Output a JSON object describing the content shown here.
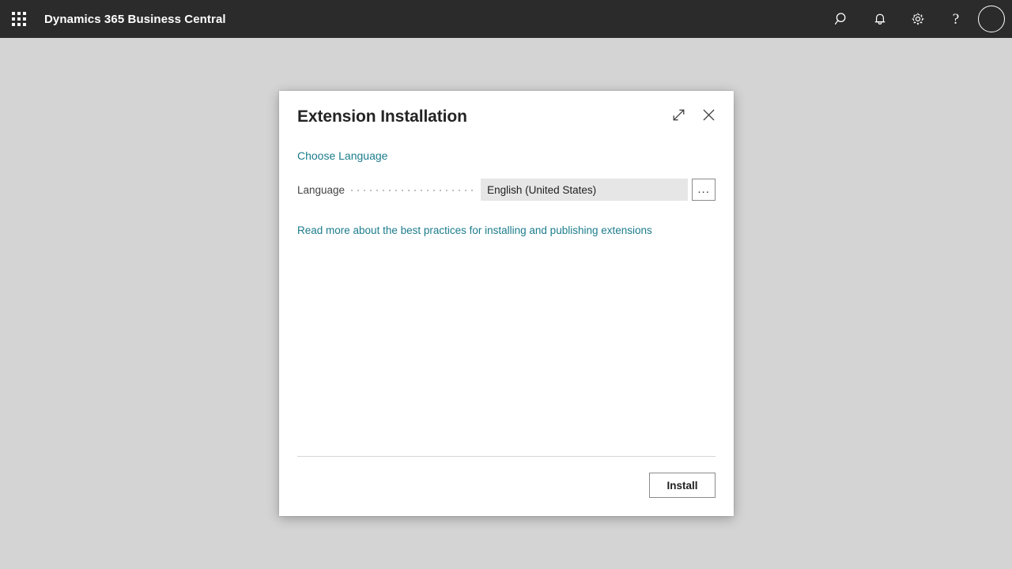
{
  "topbar": {
    "app_title": "Dynamics 365 Business Central",
    "waffle_icon": "app-launcher-grid-icon",
    "actions": [
      {
        "name": "search-icon",
        "label": "Search"
      },
      {
        "name": "notifications-bell-icon",
        "label": "Notifications"
      },
      {
        "name": "settings-gear-icon",
        "label": "Settings"
      },
      {
        "name": "help-question-icon",
        "label": "?"
      },
      {
        "name": "user-avatar",
        "label": "Account"
      }
    ],
    "background_color": "#2b2b2b",
    "foreground_color": "#ffffff"
  },
  "page": {
    "background_color": "#d4d4d4"
  },
  "dialog": {
    "title": "Extension Installation",
    "expand_icon": "expand-diagonal-icon",
    "close_icon": "close-x-icon",
    "section_link": "Choose Language",
    "field": {
      "label": "Language",
      "value": "English (United States)",
      "placeholder": "",
      "lookup_button_label": "...",
      "input_background": "#e6e6e6"
    },
    "info_link": "Read more about the best practices for installing and publishing extensions",
    "link_color": "#1c7c8c",
    "footer": {
      "primary_button": "Install"
    }
  }
}
